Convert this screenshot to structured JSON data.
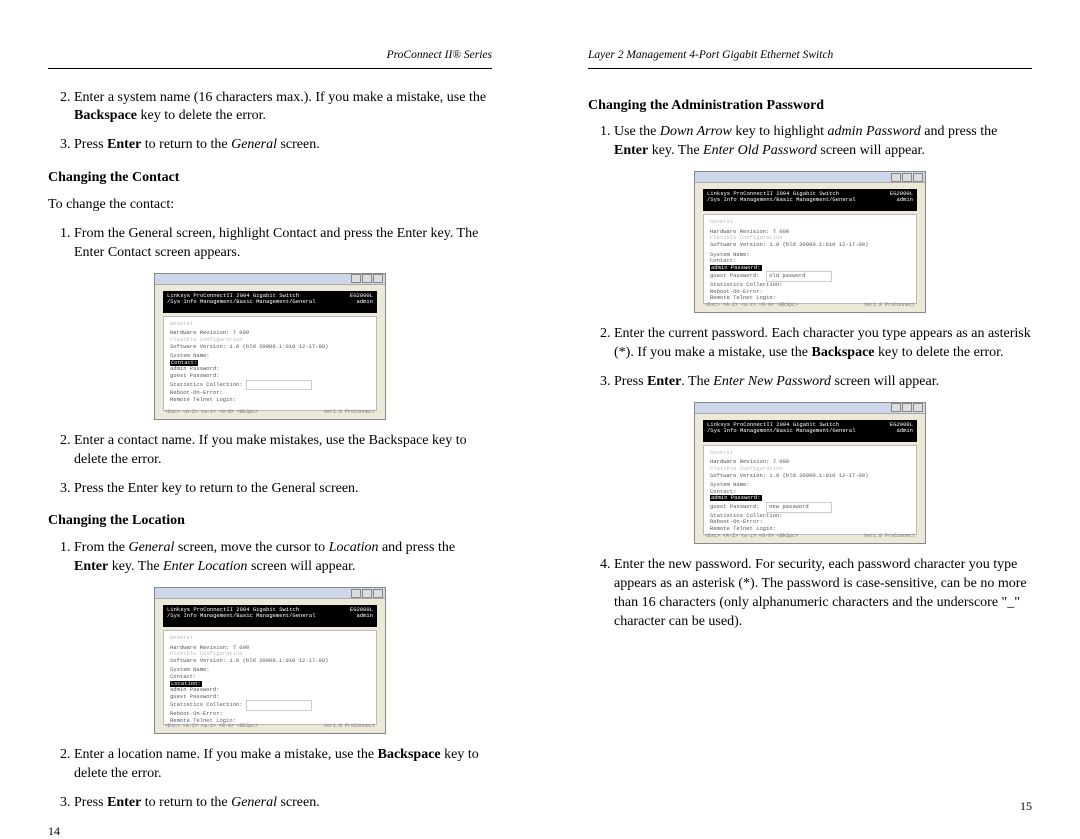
{
  "left": {
    "header": "ProConnect II® Series",
    "step2": "Enter a system name (16 characters max.). If you make a mistake, use the ",
    "step2_bold": "Backspace",
    "step2_end": " key to delete the error.",
    "step3_a": "Press ",
    "step3_b": "Enter",
    "step3_c": " to return to the ",
    "step3_d": "General",
    "step3_e": " screen.",
    "sub_contact": "Changing the Contact",
    "contact_intro": "To change the contact:",
    "c1": "From the General screen, highlight Contact and press the Enter key. The Enter Contact screen appears.",
    "c2": "Enter a contact name. If you make mistakes, use the Backspace key to delete the error.",
    "c3": "Press the Enter key to return to the General screen.",
    "sub_location": "Changing the Location",
    "l1_a": "From the ",
    "l1_b": "General",
    "l1_c": " screen, move the cursor to ",
    "l1_d": "Location",
    "l1_e": " and press the ",
    "l1_f": "Enter",
    "l1_g": " key. The ",
    "l1_h": "Enter Location",
    "l1_i": " screen will appear.",
    "l2_a": "Enter a location name. If you make a mistake, use the ",
    "l2_b": "Backspace",
    "l2_c": " key to delete the error.",
    "l3_a": "Press ",
    "l3_b": "Enter",
    "l3_c": " to return to the ",
    "l3_d": "General",
    "l3_e": " screen.",
    "page_num": "14"
  },
  "right": {
    "header": "Layer 2 Management 4-Port Gigabit Ethernet Switch",
    "sub_admin": "Changing the Administration Password",
    "a1_a": "Use the ",
    "a1_b": "Down Arrow",
    "a1_c": " key to highlight ",
    "a1_d": "admin Password",
    "a1_e": " and press the ",
    "a1_f": "Enter",
    "a1_g": "  key. The ",
    "a1_h": "Enter Old Password",
    "a1_i": " screen will appear.",
    "a2_a": "Enter the current password. Each character you type appears as an asterisk (*). If you make a mistake, use the ",
    "a2_b": "Backspace",
    "a2_c": " key to delete the error.",
    "a3_a": "Press ",
    "a3_b": "Enter",
    "a3_c": ". The ",
    "a3_d": "Enter New Password",
    "a3_e": " screen will appear.",
    "a4": "Enter the new password. For security, each password character you type appears as an asterisk (*). The password is case-sensitive, can be no more than 16 characters (only alphanumeric characters and the underscore \"_\" character can be used).",
    "page_num": "15"
  },
  "mini": {
    "banner_l1": "Linksys ProConnectII 2004 Gigabit Switch",
    "banner_l2": "/Sys Info Management/Basic Management/General",
    "banner_r1": "EG2000L",
    "banner_r2": "admin",
    "lbl_general": "General",
    "lbl_hw": "Hardware Revision: 7 000",
    "lbl_cfg": "Flexible Configuration",
    "lbl_soft": "Software Version: 1.0 (bld 20000.1:010 12-17-00)",
    "lbl_sysname": "System Name:",
    "lbl_contact": "Contact:",
    "lbl_adminpw": "admin Password:",
    "lbl_guestpw": "guest Password:",
    "lbl_stat": "Statistics Collection:",
    "lbl_reboot": "Reboot-On-Error:",
    "lbl_telnet": "Remote Telnet Login:",
    "lbl_passbox": "old pasword",
    "foot_l": "<Esc>  <A-Z>  <a-z> <0-9>  <BkSpc>",
    "foot_r": "Ver1.0 ProConnect"
  }
}
